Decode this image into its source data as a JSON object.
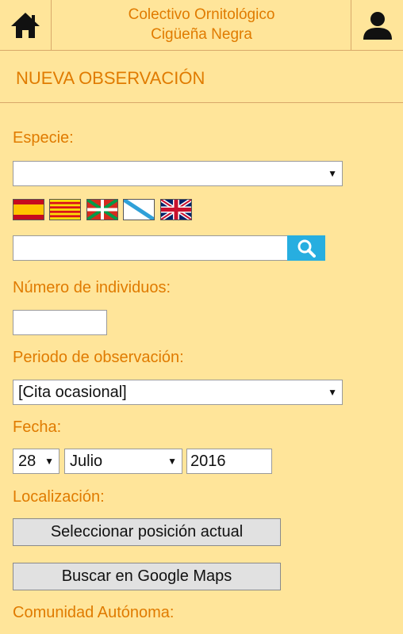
{
  "header": {
    "title_line1": "Colectivo Ornitológico",
    "title_line2": "Cigüeña Negra",
    "home_icon": "home-icon",
    "user_icon": "user-icon"
  },
  "page": {
    "title": "NUEVA OBSERVACIÓN"
  },
  "form": {
    "species_label": "Especie:",
    "species_value": "",
    "languages": [
      "es",
      "ca",
      "eu",
      "gl",
      "en"
    ],
    "search_value": "",
    "individuals_label": "Número de individuos:",
    "individuals_value": "",
    "period_label": "Periodo de observación:",
    "period_value": "[Cita ocasional]",
    "date_label": "Fecha:",
    "date_day": "28",
    "date_month": "Julio",
    "date_year": "2016",
    "location_label": "Localización:",
    "current_position_button": "Seleccionar posición actual",
    "google_maps_button": "Buscar en Google Maps",
    "region_label": "Comunidad Autónoma:"
  },
  "colors": {
    "background": "#ffe59a",
    "accent_text": "#e07b00",
    "search_button": "#27aee0"
  }
}
